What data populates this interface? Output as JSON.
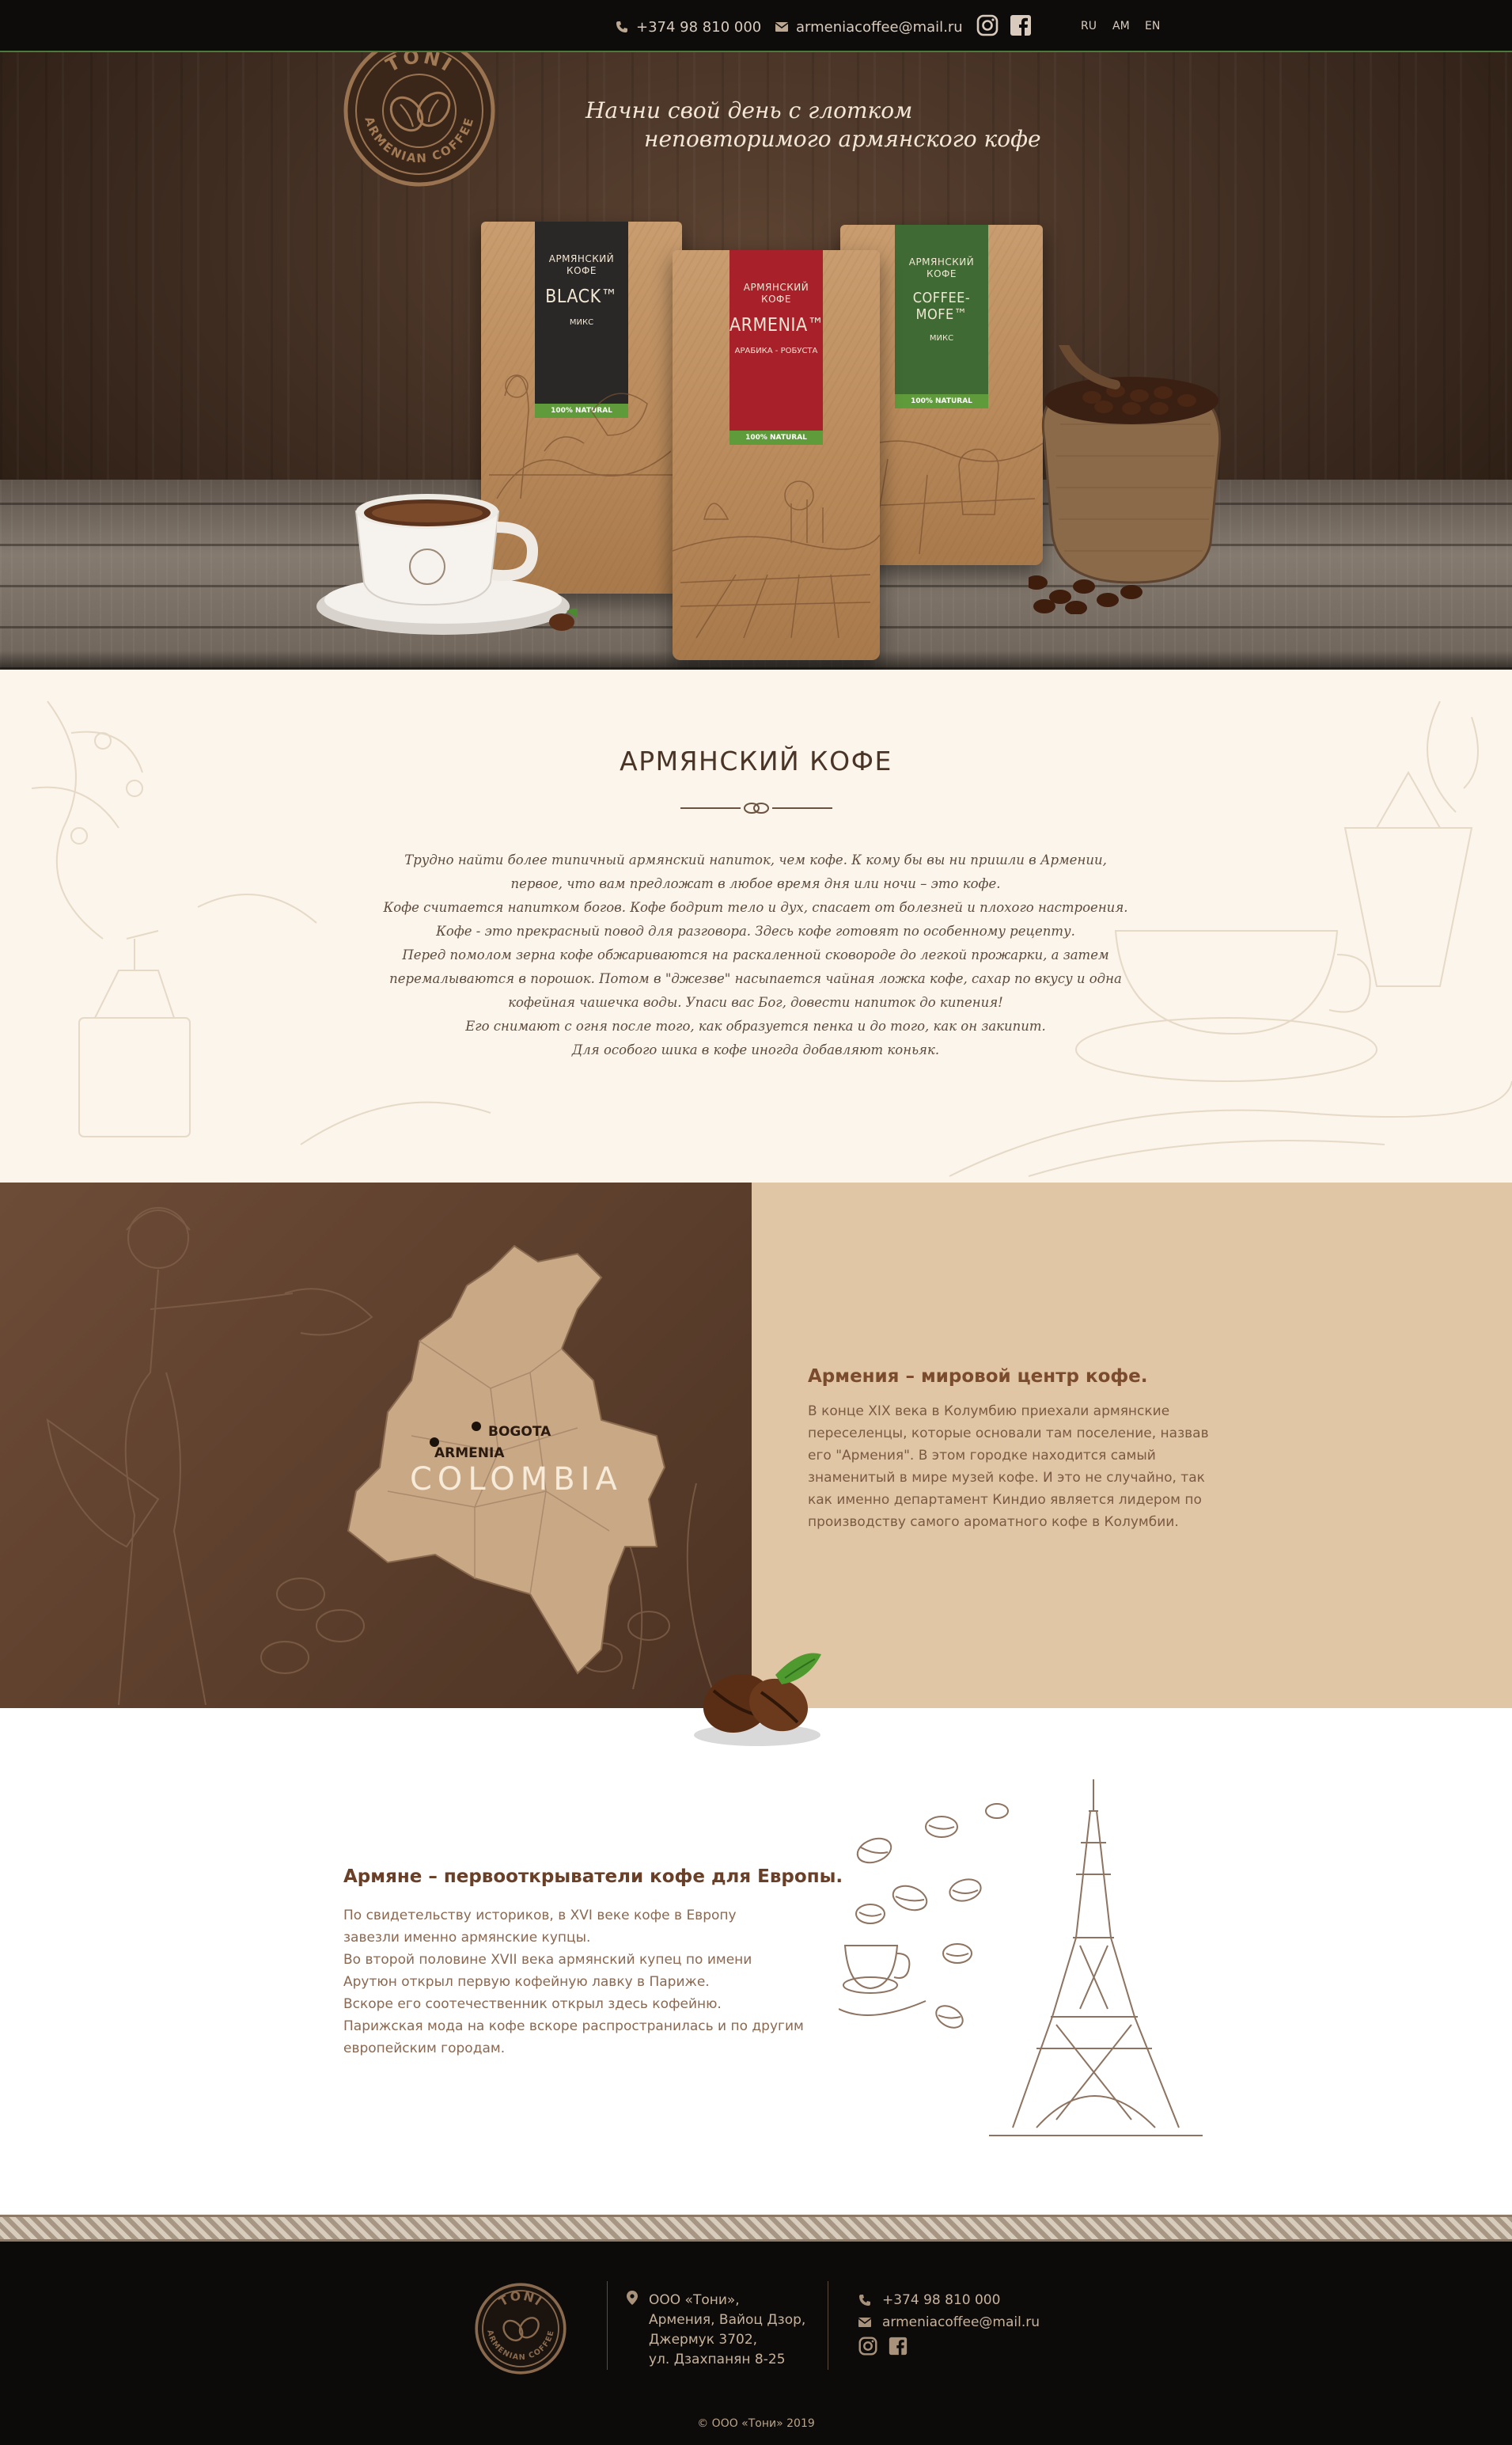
{
  "topbar": {
    "phone": "+374 98 810 000",
    "email": "armeniacoffee@mail.ru",
    "social": [
      "instagram-icon",
      "facebook-icon"
    ],
    "languages": [
      "RU",
      "AM",
      "EN"
    ]
  },
  "logo": {
    "top_text": "TONI",
    "side_text": "ARMENIAN COFFEE"
  },
  "hero": {
    "tagline_line1": "Начни свой день с глотком",
    "tagline_line2": "неповторимого армянского кофе",
    "products": [
      {
        "kofe": "АРМЯНСКИЙ КОФЕ",
        "name": "BLACK™",
        "sub": "МИКС",
        "badge": "100% NATURAL",
        "band_color": "#2a2826"
      },
      {
        "kofe": "АРМЯНСКИЙ КОФЕ",
        "name": "ARMENIA™",
        "sub": "АРАБИКА - РОБУСТА",
        "badge": "100% NATURAL",
        "band_color": "#a8202a"
      },
      {
        "kofe": "АРМЯНСКИЙ КОФЕ",
        "name": "COFFEE-MOFE™",
        "sub": "МИКС",
        "badge": "100% NATURAL",
        "band_color": "#3f6a33"
      }
    ]
  },
  "about": {
    "title": "АРМЯНСКИЙ КОФЕ",
    "paragraphs": [
      "Трудно найти более типичный армянский напиток, чем кофе. К кому бы вы ни пришли в Армении,",
      "первое, что вам предложат в любое время дня или ночи – это кофе.",
      "Кофе считается напитком богов. Кофе бодрит тело и дух, спасает от болезней и плохого настроения.",
      "Кофе - это прекрасный повод для разговора. Здесь кофе готовят по особенному рецепту.",
      "Перед помолом зерна кофе обжариваются на раскаленной сковороде до легкой прожарки, а затем",
      "перемалываются в порошок. Потом в \"джезве\" насыпается чайная ложка кофе, сахар по вкусу и одна",
      "кофейная чашечка воды. Упаси вас Бог, довести напиток до кипения!",
      "Его снимают с огня после того, как образуется пенка и до того, как он закипит.",
      "Для особого шика в кофе иногда добавляют коньяк."
    ]
  },
  "colombia": {
    "country": "COLOMBIA",
    "city_armenia": "ARMENIA",
    "city_bogota": "BOGOTA",
    "title": "Армения – мировой центр кофе.",
    "text": "В конце XIX века в Колумбию приехали армянские переселенцы, которые основали там  поселение, назвав его \"Армения\". В этом городке находится самый знаменитый в мире музей кофе. И это не случайно, так как именно департамент Киндио является лидером по производству самого ароматного кофе в Колумбии."
  },
  "paris": {
    "title": "Армяне – первооткрыватели кофе для Европы.",
    "lines": [
      "По свидетельству историков, в XVI веке кофе в Европу",
      "завезли именно армянские купцы.",
      "Во второй половине XVII века армянский купец по имени",
      "Арутюн открыл первую кофейную лавку в Париже.",
      "Вскоре его соотечественник открыл здесь кофейню.",
      "Парижская мода на кофе вскоре распространилась и по другим",
      "европейским городам."
    ]
  },
  "footer": {
    "address": [
      "ООО «Тони»,",
      "Армения, Вайоц Дзор,",
      "Джермук 3702,",
      "ул. Дзахпанян 8-25"
    ],
    "phone": "+374 98 810 000",
    "email": "armeniacoffee@mail.ru",
    "copyright": "© ООО «Тони» 2019"
  }
}
